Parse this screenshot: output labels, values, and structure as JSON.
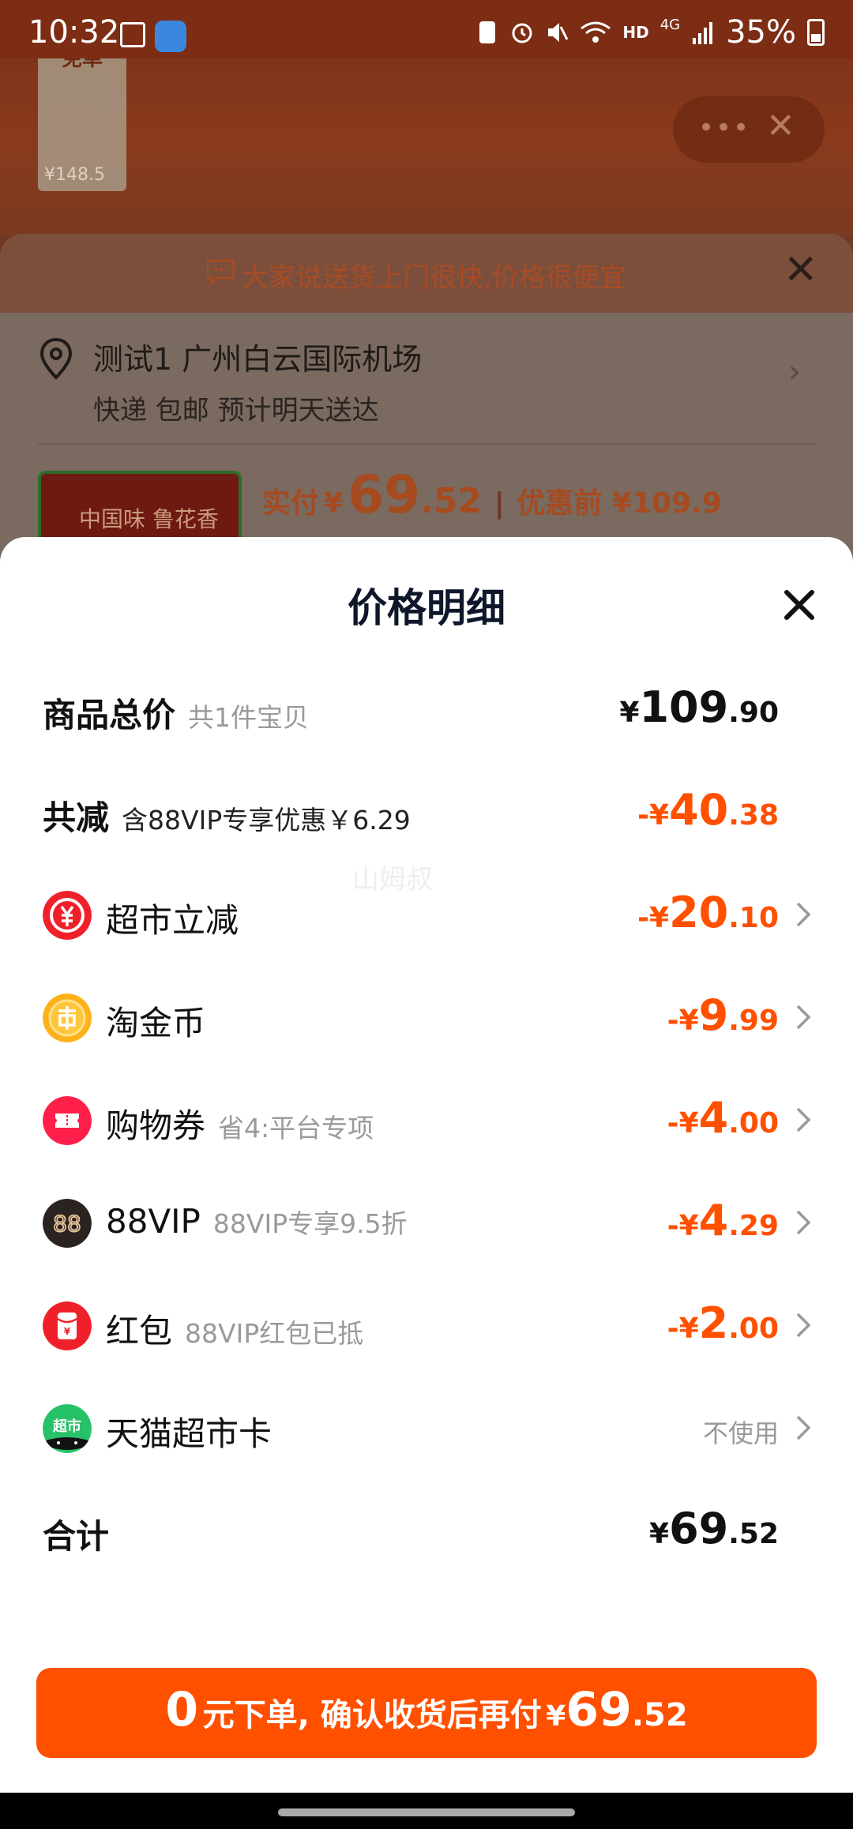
{
  "status_bar": {
    "time": "10:32",
    "network": "4G",
    "hd": "HD",
    "battery": "35%"
  },
  "background": {
    "thumb_label": "免单",
    "thumb_price": "¥148.5",
    "banner_text": "大家说送货上门很快,价格很便宜",
    "address": "测试1 广州白云国际机场",
    "delivery": "快递 包邮 预计明天送达",
    "product_thumb_text": "中国味 鲁花香",
    "pay_label": "实付",
    "pay_currency": "¥",
    "pay_int": "69",
    "pay_dec": ".52",
    "pre_discount": "优惠前 ¥109.9"
  },
  "modal": {
    "title": "价格明细",
    "rows": [
      {
        "label": "商品总价",
        "sub": "共1件宝贝",
        "currency": "¥",
        "int": "109",
        "dec": ".90"
      },
      {
        "label": "共减",
        "sub": "含88VIP专享优惠￥6.29",
        "currency": "-¥",
        "int": "40",
        "dec": ".38"
      },
      {
        "label": "超市立减",
        "sub": "",
        "currency": "-¥",
        "int": "20",
        "dec": ".10"
      },
      {
        "label": "淘金币",
        "sub": "",
        "currency": "-¥",
        "int": "9",
        "dec": ".99"
      },
      {
        "label": "购物券",
        "sub": "省4:平台专项",
        "currency": "-¥",
        "int": "4",
        "dec": ".00"
      },
      {
        "label": "88VIP",
        "sub": "88VIP专享9.5折",
        "currency": "-¥",
        "int": "4",
        "dec": ".29"
      },
      {
        "label": "红包",
        "sub": "88VIP红包已抵",
        "currency": "-¥",
        "int": "2",
        "dec": ".00"
      },
      {
        "label": "天猫超市卡",
        "sub": "",
        "value": "不使用"
      },
      {
        "label": "合计",
        "sub": "",
        "currency": "¥",
        "int": "69",
        "dec": ".52"
      }
    ],
    "watermark": "山姆叔"
  },
  "cta": {
    "zero": "0",
    "text": "元下单, 确认收货后再付",
    "currency": "¥",
    "int": "69",
    "dec": ".52"
  },
  "colors": {
    "accent": "#ff5000",
    "text_primary": "#111111",
    "text_secondary": "#9a9a9a"
  },
  "icons": [
    "close-icon",
    "location-pin-icon",
    "chat-bubble-icon",
    "chevron-right-icon",
    "yuan-coin-icon",
    "gold-coin-icon",
    "ticket-icon",
    "vip88-icon",
    "red-envelope-icon",
    "tmall-supermarket-icon"
  ]
}
